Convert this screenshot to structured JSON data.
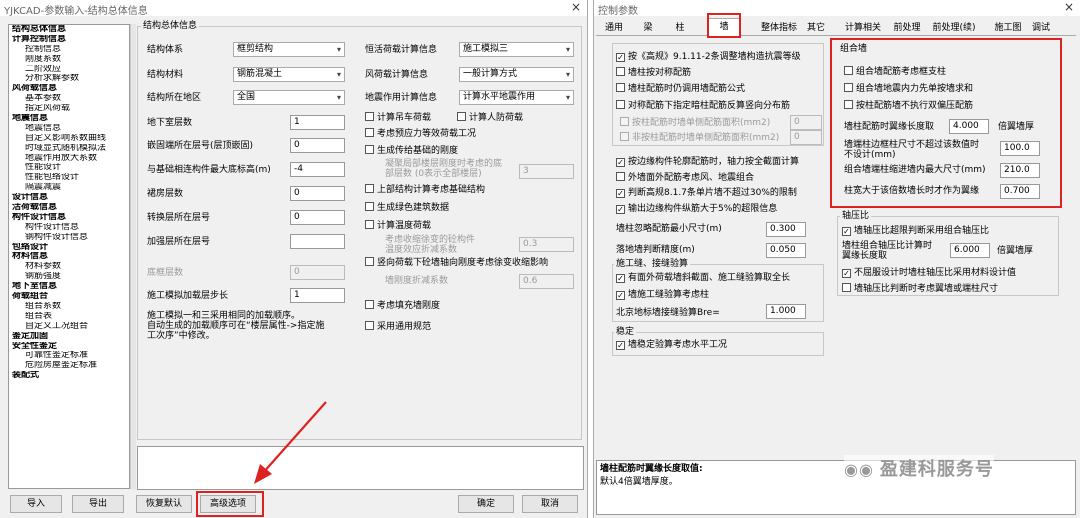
{
  "left": {
    "title": "YJKCAD-参数输入-结构总体信息",
    "close": "×",
    "tree": [
      {
        "t": "结构总体信息",
        "b": true
      },
      {
        "t": "计算控制信息",
        "b": true
      },
      {
        "t": "控制信息",
        "b": false
      },
      {
        "t": "刚度系数",
        "b": false
      },
      {
        "t": "二阶效应",
        "b": false
      },
      {
        "t": "分析求解参数",
        "b": false
      },
      {
        "t": "风荷载信息",
        "b": true
      },
      {
        "t": "基本参数",
        "b": false
      },
      {
        "t": "指定风荷载",
        "b": false
      },
      {
        "t": "地震信息",
        "b": true
      },
      {
        "t": "地震信息",
        "b": false
      },
      {
        "t": "自定义影响系数曲线",
        "b": false
      },
      {
        "t": "时域显式随机模拟法",
        "b": false
      },
      {
        "t": "地震作用放大系数",
        "b": false
      },
      {
        "t": "性能设计",
        "b": false
      },
      {
        "t": "性能包络设计",
        "b": false
      },
      {
        "t": "隔震减震",
        "b": false
      },
      {
        "t": "设计信息",
        "b": true
      },
      {
        "t": "活荷载信息",
        "b": true
      },
      {
        "t": "构件设计信息",
        "b": true
      },
      {
        "t": "构件设计信息",
        "b": false
      },
      {
        "t": "钢构件设计信息",
        "b": false
      },
      {
        "t": "包络设计",
        "b": true
      },
      {
        "t": "材料信息",
        "b": true
      },
      {
        "t": "材料参数",
        "b": false
      },
      {
        "t": "钢筋强度",
        "b": false
      },
      {
        "t": "地下室信息",
        "b": true
      },
      {
        "t": "荷载组合",
        "b": true
      },
      {
        "t": "组合系数",
        "b": false
      },
      {
        "t": "组合表",
        "b": false
      },
      {
        "t": "自定义工况组合",
        "b": false
      },
      {
        "t": "鉴定加固",
        "b": true
      },
      {
        "t": "安全性鉴定",
        "b": true
      },
      {
        "t": "可靠性鉴定标准",
        "b": false
      },
      {
        "t": "危险房屋鉴定标准",
        "b": false
      },
      {
        "t": "装配式",
        "b": true
      }
    ],
    "group_title": "结构总体信息",
    "struct_type_label": "结构体系",
    "struct_type_value": "框剪结构",
    "material_label": "结构材料",
    "material_value": "钢筋混凝土",
    "region_label": "结构所在地区",
    "region_value": "全国",
    "basement_label": "地下室层数",
    "basement_value": "1",
    "embed_label": "嵌固端所在层号(层顶嵌固)",
    "embed_value": "0",
    "foundation_label": "与基础相连构件最大底标高(m)",
    "foundation_value": "-4",
    "podium_label": "裙房层数",
    "podium_value": "0",
    "transfer_label": "转换层所在层号",
    "transfer_value": "0",
    "strength_label": "加强层所在层号",
    "strength_value": "",
    "bottom_label": "底框层数",
    "bottom_value": "0",
    "step_label": "施工模拟加载层步长",
    "step_value": "1",
    "step_note": [
      "施工模拟一和三采用相同的加载顺序。",
      "自动生成的加载顺序可在“楼层属性->指定施",
      "工次序”中修改。"
    ],
    "dead_load_label": "恒活荷载计算信息",
    "dead_load_value": "施工模拟三",
    "wind_label": "风荷载计算信息",
    "wind_value": "一般计算方式",
    "quake_label": "地震作用计算信息",
    "quake_value": "计算水平地震作用",
    "crane_label": "计算吊车荷载",
    "air_label": "计算人防荷载",
    "prestress_label": "考虑预应力等效荷载工况",
    "foundation_stiff_label": "生成传给基础的刚度",
    "stiff_layers_label": [
      "凝聚局部楼层刚度时考虑的底",
      "部层数 (0表示全部楼层)"
    ],
    "stiff_layers_value": "3",
    "upper_label": "上部结构计算考虑基础结构",
    "green_label": "生成绿色建筑数据",
    "temp_label": "计算温度荷载",
    "concrete_label": [
      "考虑收缩徐变的砼构件",
      "温度效应折减系数"
    ],
    "concrete_value": "0.3",
    "vertical_label": "竖向荷载下砼墙轴向刚度考虑徐变收缩影响",
    "wall_reduce_label": "墙刚度折减系数",
    "wall_reduce_value": "0.6",
    "infill_label": "考虑填充墙刚度",
    "common_label": "采用通用规范",
    "buttons": {
      "import": "导入",
      "export": "导出",
      "restore": "恢复默认",
      "advanced": "高级选项",
      "ok": "确定",
      "cancel": "取消"
    }
  },
  "right": {
    "title": "控制参数",
    "close": "×",
    "tabs": [
      "通用",
      "梁",
      "柱",
      "墙",
      "整体指标",
      "其它",
      "计算相关",
      "前处理",
      "前处理(续)",
      "施工图",
      "调试"
    ],
    "by_code_label": "按《高规》9.1.11-2条调整墙构造抗震等级",
    "wall_col_label": "墙柱按对称配筋",
    "wall_rebar_label": "墙柱配筋时仍调用墙配筋公式",
    "sym_label": "对称配筋下指定暗柱配筋反算竖向分布筋",
    "wall_side_label": "按柱配筋时墙单侧配筋面积(mm2)",
    "wall_side_value": "0",
    "non_col_label": "非按柱配筋时墙单侧配筋面积(mm2)",
    "non_col_value": "0",
    "contour_label": "按边缘构件轮廓配筋时，轴力按全截面计算",
    "outer_label": "外墙面外配筋考虑风、地震组合",
    "single_label": "判断高规8.1.7条单片墙不超过30%的限制",
    "output_label": "输出边缘构件纵筋大于5%的超限信息",
    "min_size_label": "墙柱忽略配筋最小尺寸(m)",
    "min_size_value": "0.300",
    "precision_label": "落地墙判断精度(m)",
    "precision_value": "0.050",
    "const_title": "施工缝、接缝验算",
    "const1_label": "有面外荷载墙斜截面、施工缝验算取全长",
    "const2_label": "墙施工缝验算考虑柱",
    "beijing_label": "北京地标墙接缝验算Bre=",
    "beijing_value": "1.000",
    "stable_title": "稳定",
    "stable_label": "墙稳定验算考虑水平工况",
    "combo_title": "组合墙",
    "combo1_label": "组合墙配筋考虑框支柱",
    "combo2_label": "组合墙地震内力先单按墙求和",
    "combo3_label": "按柱配筋墙不执行双偏压配筋",
    "flange_label": "墙柱配筋时翼缘长度取",
    "flange_value": "4.000",
    "flange_unit": "倍翼墙厚",
    "endcol_label": [
      "墙端柱边框柱尺寸不超过该数值时",
      "不设计(mm)"
    ],
    "endcol_value": "100.0",
    "combo_col_label": "组合墙端柱缩进墙内最大尺寸(mm)",
    "combo_col_value": "210.0",
    "col_width_label": "柱宽大于该倍数墙长时才作为翼缘",
    "col_width_value": "0.700",
    "axial_title": "轴压比",
    "axial1_label": "墙轴压比超限判断采用组合轴压比",
    "axial2_label": [
      "墙柱组合轴压比计算时",
      "翼缘长度取"
    ],
    "axial2_value": "6.000",
    "axial2_unit": "倍翼墙厚",
    "axial3_label": "不屈服设计时墙柱轴压比采用材料设计值",
    "axial4_label": "墙轴压比判断时考虑翼墙或端柱尺寸",
    "status_title": "墙柱配筋时翼缘长度取值:",
    "status_text": "默认4倍翼墙厚度。",
    "watermark": "盈建科服务号"
  },
  "colors": {
    "highlight": "#d22222",
    "panel": "#f0f0f0"
  }
}
